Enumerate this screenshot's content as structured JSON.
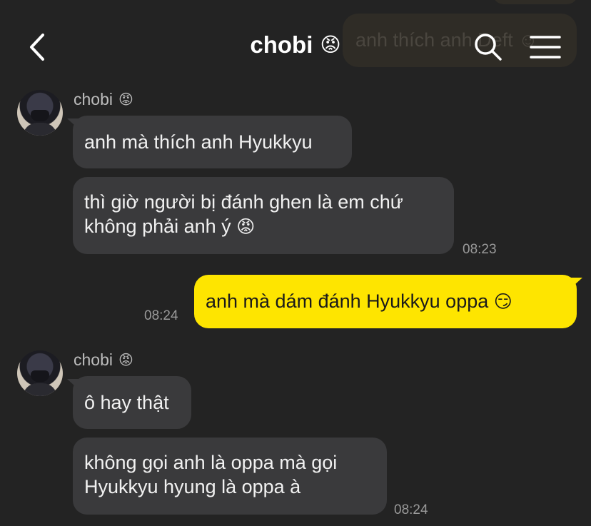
{
  "header": {
    "title": "chobi",
    "title_emoji": "😡",
    "ghost_text": "anh thích anh Deft ☺"
  },
  "groups": [
    {
      "sender": "chobi",
      "sender_emoji": "😡",
      "messages": [
        {
          "text": "anh mà thích anh Hyukkyu"
        },
        {
          "line1": "thì giờ người bị đánh ghen là em chứ",
          "line2": "không phải anh ý",
          "emoji": "😡",
          "time": "08:23"
        }
      ]
    },
    {
      "sender": "chobi",
      "sender_emoji": "😡",
      "messages": [
        {
          "text": "ô hay thật"
        },
        {
          "line1": "không gọi anh là oppa mà gọi",
          "line2": "Hyukkyu hyung là oppa à",
          "time": "08:24"
        }
      ]
    }
  ],
  "mine": {
    "text": "anh mà dám đánh Hyukkyu oppa",
    "emoji": "😏",
    "time": "08:24"
  },
  "icons": {
    "back": "chevron-left-icon",
    "search": "search-icon",
    "menu": "hamburger-menu-icon"
  },
  "colors": {
    "background": "#232323",
    "bubble_other": "#3a3a3c",
    "bubble_mine": "#fee500"
  }
}
